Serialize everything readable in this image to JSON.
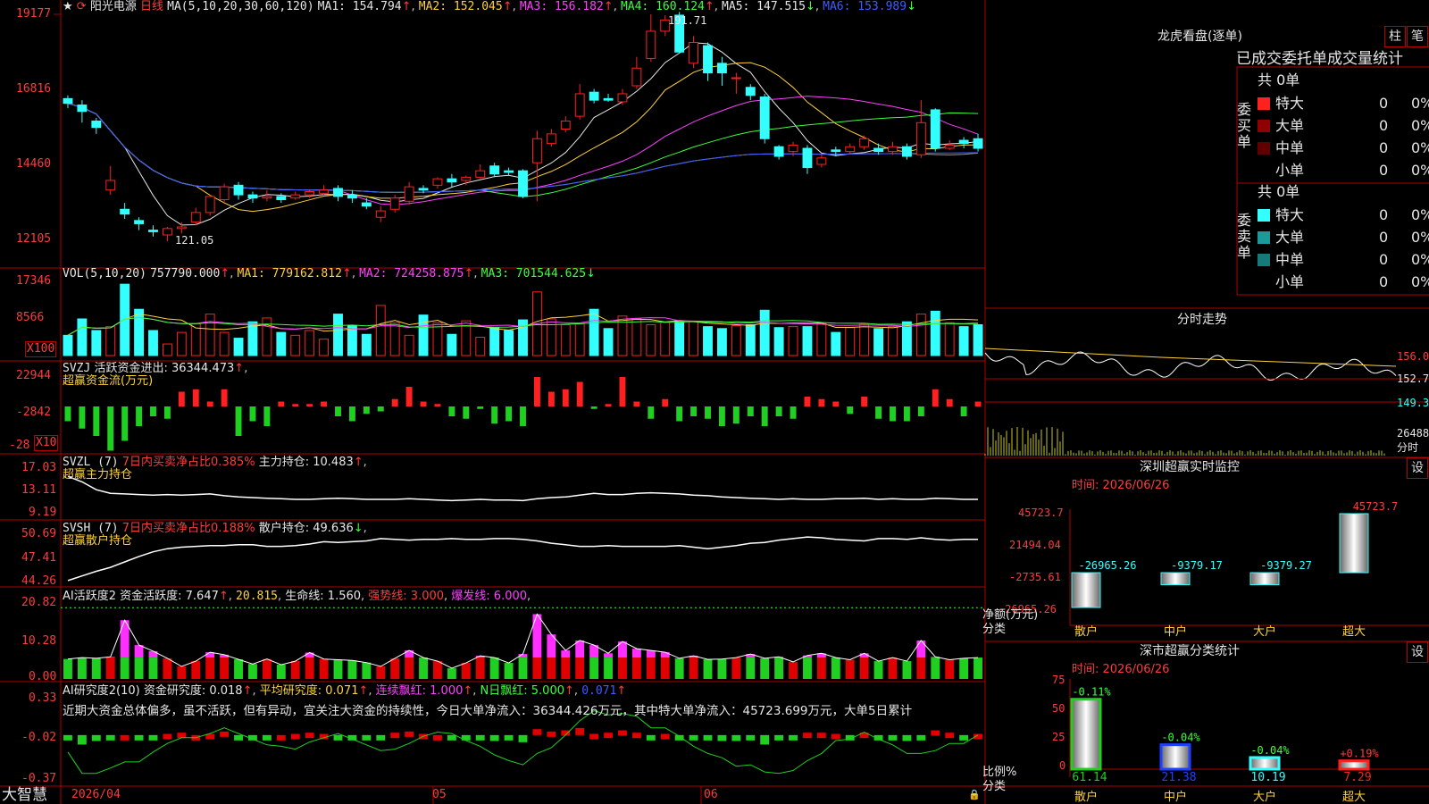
{
  "colors": {
    "up": "#ff2020",
    "down": "#3ff",
    "frame": "#b00000",
    "ma1": "#e6e6e6",
    "ma2": "#ffd23a",
    "ma3": "#ff40ff",
    "ma4": "#3cff3c",
    "ma5": "#9a9a9a",
    "ma6": "#3d5dff"
  },
  "header": {
    "star": "★",
    "stock": "阳光电源",
    "period": "日线",
    "ma_params": "MA(5,10,20,30,60,120)",
    "ma1": "MA1: 154.794",
    "ma2": "MA2: 152.045",
    "ma3": "MA3: 156.182",
    "ma4": "MA4: 160.124",
    "ma5": "MA5: 147.515",
    "ma6": "MA6: 153.989"
  },
  "price_axis": [
    "19177",
    "16816",
    "14460",
    "12105"
  ],
  "price_annotations": {
    "high": "191.71",
    "low": "121.05"
  },
  "vol_header": {
    "name": "VOL(5,10,20)",
    "v": "757790.000",
    "ma1": "MA1: 779162.812",
    "ma2": "MA2: 724258.875",
    "ma3": "MA3: 701544.625"
  },
  "vol_axis": [
    "17346",
    "8566",
    "X100"
  ],
  "svzj_header": {
    "name": "SVZJ",
    "text": "活跃资金进出: 36344.473",
    "sub": "超赢资金流(万元)"
  },
  "svzj_axis": [
    "22944",
    "-2842",
    "-28",
    "X10"
  ],
  "svzl_header": {
    "name": "SVZL (7)",
    "ratio": "7日内买卖净占比0.385%",
    "hold": "主力持仓: 10.483",
    "sub": "超赢主力持仓"
  },
  "svzl_axis": [
    "17.03",
    "13.11",
    "9.19"
  ],
  "svsh_header": {
    "name": "SVSH (7)",
    "ratio": "7日内买卖净占比0.188%",
    "hold": "散户持仓: 49.636",
    "sub": "超赢散户持仓"
  },
  "svsh_axis": [
    "50.69",
    "47.41",
    "44.26"
  ],
  "ai1_header": {
    "name": "AI活跃度2",
    "active": "资金活跃度: 7.647",
    "v2": "20.815",
    "life": "生命线: 1.560",
    "strong": "强势线: 3.000",
    "burst": "爆发线: 6.000"
  },
  "ai1_axis": [
    "20.82",
    "10.28",
    "0.00"
  ],
  "ai2_header": {
    "name": "AI研究度2(10)",
    "fund": "资金研究度: 0.018",
    "avg": "平均研究度: 0.071",
    "red": "连续飘红: 1.000",
    "nred": "N日飘红: 5.000",
    "last": "0.071"
  },
  "ai2_axis": [
    "0.33",
    "-0.02",
    "-0.37"
  ],
  "commentary": "近期大资金总体偏多，虽不活跃，但有异动，宜关注大资金的持续性，今日大单净流入：36344.426万元，其中特大单净流入：45723.699万元，大单5日累计",
  "bottom": {
    "brand": "大智慧",
    "dates": [
      "2026/04",
      "05",
      "06"
    ]
  },
  "right": {
    "title": "龙虎看盘(逐单)",
    "btn1": "柱",
    "btn2": "笔",
    "heading": "已成交委托单成交量统计",
    "buy": {
      "label": "委买单",
      "total": "共 0单",
      "rows": [
        {
          "name": "特大",
          "v": "0",
          "p": "0%",
          "c": "#ff2020"
        },
        {
          "name": "大单",
          "v": "0",
          "p": "0%",
          "c": "#900000"
        },
        {
          "name": "中单",
          "v": "0",
          "p": "0%",
          "c": "#600000"
        },
        {
          "name": "小单",
          "v": "0",
          "p": "0%",
          "c": ""
        }
      ]
    },
    "sell": {
      "label": "委卖单",
      "total": "共 0单",
      "rows": [
        {
          "name": "特大",
          "v": "0",
          "p": "0%",
          "c": "#3ff"
        },
        {
          "name": "大单",
          "v": "0",
          "p": "0%",
          "c": "#1a9a9a"
        },
        {
          "name": "中单",
          "v": "0",
          "p": "0%",
          "c": "#157a7a"
        },
        {
          "name": "小单",
          "v": "0",
          "p": "0%",
          "c": ""
        }
      ]
    },
    "intraday": {
      "title": "分时走势",
      "axis": [
        "156.0",
        "152.7",
        "149.3",
        "26488"
      ],
      "unit": "分时"
    },
    "monitor": {
      "title": "深圳超赢实时监控",
      "btn": "设",
      "time": "时间: 2026/06/26",
      "axis": [
        "45723.7",
        "21494.04",
        "-2735.61",
        "-26965.26"
      ],
      "ylabel": "净额(万元)",
      "xlabel": "分类",
      "cats": [
        "散户",
        "中户",
        "大户",
        "超大"
      ],
      "values": [
        -26965.26,
        -9379.17,
        -9379.27,
        45723.7
      ],
      "labels": [
        "-26965.26",
        "-9379.17",
        "-9379.27",
        "45723.7"
      ]
    },
    "stats": {
      "title": "深市超赢分类统计",
      "btn": "设",
      "time": "时间: 2026/06/26",
      "axis": [
        "75",
        "50",
        "25",
        "0"
      ],
      "ylabel": "比例%",
      "xlabel": "分类",
      "cats": [
        "散户",
        "中户",
        "大户",
        "超大"
      ],
      "values": [
        61.14,
        21.38,
        10.19,
        7.29
      ],
      "changes": [
        "-0.11%",
        "-0.04%",
        "-0.04%",
        "+0.19%"
      ]
    }
  },
  "chart_data": {
    "type": "candlestick",
    "title": "阳光电源 日线",
    "xlabel": "",
    "ylabel": "",
    "x_ticks": [
      "2026/04",
      "05",
      "06"
    ],
    "ylim": [
      121.05,
      191.77
    ],
    "candles": [
      [
        165.5,
        164.0,
        166.5,
        162.5
      ],
      [
        163.5,
        161.5,
        165.0,
        158.0
      ],
      [
        158.5,
        156.5,
        159.5,
        154.5
      ],
      [
        137.0,
        140.0,
        144.5,
        135.5
      ],
      [
        131.0,
        129.5,
        133.0,
        128.0
      ],
      [
        127.5,
        126.5,
        128.5,
        124.5
      ],
      [
        124.5,
        124.0,
        126.0,
        122.5
      ],
      [
        123.0,
        125.0,
        125.5,
        121.05
      ],
      [
        125.0,
        125.5,
        127.0,
        123.5
      ],
      [
        127.0,
        130.0,
        131.5,
        126.0
      ],
      [
        130.0,
        135.0,
        135.5,
        129.0
      ],
      [
        134.0,
        138.0,
        139.0,
        133.0
      ],
      [
        138.5,
        135.5,
        139.5,
        134.0
      ],
      [
        135.5,
        134.5,
        136.5,
        133.0
      ],
      [
        134.5,
        135.0,
        137.0,
        133.5
      ],
      [
        135.0,
        134.0,
        136.0,
        133.0
      ],
      [
        134.5,
        135.5,
        136.5,
        134.0
      ],
      [
        135.5,
        136.5,
        137.0,
        134.5
      ],
      [
        136.0,
        137.0,
        138.5,
        135.5
      ],
      [
        137.5,
        135.0,
        138.5,
        133.5
      ],
      [
        135.5,
        134.5,
        137.0,
        133.0
      ],
      [
        133.0,
        132.0,
        134.5,
        131.0
      ],
      [
        128.5,
        130.5,
        132.0,
        127.0
      ],
      [
        131.0,
        134.5,
        135.5,
        130.0
      ],
      [
        133.5,
        138.0,
        139.5,
        132.5
      ],
      [
        137.5,
        137.0,
        138.5,
        136.0
      ],
      [
        138.5,
        140.5,
        141.0,
        137.5
      ],
      [
        140.5,
        139.5,
        142.0,
        138.0
      ],
      [
        140.0,
        141.0,
        141.5,
        138.5
      ],
      [
        141.0,
        143.0,
        145.0,
        140.5
      ],
      [
        144.5,
        142.0,
        145.5,
        141.0
      ],
      [
        143.0,
        142.5,
        144.0,
        141.5
      ],
      [
        143.0,
        135.0,
        143.5,
        134.5
      ],
      [
        145.5,
        153.0,
        155.5,
        133.5
      ],
      [
        151.5,
        154.5,
        156.0,
        150.5
      ],
      [
        156.0,
        158.5,
        160.0,
        155.0
      ],
      [
        160.0,
        167.0,
        170.0,
        159.0
      ],
      [
        167.5,
        165.0,
        168.5,
        164.0
      ],
      [
        165.5,
        165.0,
        167.0,
        164.5
      ],
      [
        164.5,
        167.0,
        168.5,
        163.5
      ],
      [
        169.5,
        175.0,
        178.5,
        168.5
      ],
      [
        178.0,
        186.5,
        191.77,
        177.0
      ],
      [
        186.5,
        190.0,
        191.5,
        185.0
      ],
      [
        191.5,
        180.0,
        192.5,
        179.5
      ],
      [
        176.5,
        183.0,
        185.0,
        175.0
      ],
      [
        182.0,
        173.5,
        183.0,
        171.0
      ],
      [
        176.5,
        173.5,
        178.5,
        169.5
      ],
      [
        172.0,
        172.0,
        173.5,
        167.0
      ],
      [
        169.0,
        166.5,
        170.0,
        165.0
      ],
      [
        166.0,
        153.0,
        167.0,
        151.5
      ],
      [
        150.5,
        147.5,
        151.0,
        146.5
      ],
      [
        149.0,
        151.0,
        152.0,
        147.5
      ],
      [
        150.0,
        144.0,
        151.0,
        142.0
      ],
      [
        145.0,
        147.0,
        148.5,
        144.0
      ],
      [
        149.5,
        149.0,
        150.5,
        147.5
      ],
      [
        149.0,
        150.5,
        151.5,
        148.0
      ],
      [
        150.5,
        153.0,
        154.0,
        149.5
      ],
      [
        150.0,
        149.0,
        151.5,
        148.0
      ],
      [
        149.0,
        150.5,
        152.0,
        148.0
      ],
      [
        150.5,
        147.5,
        151.5,
        146.5
      ],
      [
        148.0,
        158.0,
        165.0,
        147.0
      ],
      [
        162.0,
        150.0,
        162.5,
        149.0
      ],
      [
        150.0,
        151.0,
        152.5,
        149.5
      ],
      [
        152.5,
        151.5,
        153.5,
        150.0
      ],
      [
        153.0,
        150.0,
        154.5,
        149.0
      ]
    ],
    "volume": [
      210,
      380,
      260,
      300,
      740,
      480,
      260,
      120,
      240,
      330,
      430,
      240,
      180,
      350,
      390,
      240,
      210,
      260,
      170,
      430,
      310,
      220,
      520,
      340,
      210,
      420,
      340,
      220,
      360,
      190,
      290,
      260,
      370,
      660,
      380,
      320,
      330,
      480,
      280,
      410,
      380,
      320,
      350,
      360,
      350,
      300,
      280,
      310,
      320,
      470,
      290,
      300,
      300,
      330,
      240,
      290,
      330,
      280,
      300,
      350,
      430,
      460,
      340,
      300,
      320
    ],
    "svzj": [
      -30,
      -45,
      -60,
      -90,
      -70,
      -40,
      -20,
      -25,
      30,
      35,
      10,
      35,
      -60,
      -30,
      -40,
      10,
      5,
      5,
      10,
      -20,
      -30,
      -15,
      -10,
      15,
      40,
      10,
      5,
      -20,
      -25,
      -5,
      -35,
      -30,
      -40,
      60,
      30,
      35,
      50,
      -5,
      5,
      60,
      10,
      -25,
      15,
      -30,
      -20,
      -25,
      -40,
      -35,
      -20,
      -40,
      -20,
      -25,
      20,
      15,
      10,
      -15,
      20,
      -25,
      -30,
      -30,
      -20,
      35,
      15,
      -20,
      10
    ],
    "svzl": [
      15.8,
      14.9,
      13.6,
      13.0,
      12.9,
      12.8,
      12.7,
      12.8,
      12.7,
      12.8,
      12.9,
      12.6,
      12.4,
      12.3,
      12.2,
      12.1,
      12.0,
      12.0,
      12.1,
      12.2,
      12.1,
      12.0,
      12.0,
      12.0,
      12.1,
      12.0,
      11.9,
      11.8,
      11.9,
      12.0,
      11.9,
      11.9,
      11.8,
      12.1,
      12.3,
      12.4,
      12.7,
      13.0,
      12.8,
      12.8,
      13.0,
      13.1,
      13.0,
      12.9,
      12.7,
      12.6,
      12.4,
      12.3,
      12.2,
      12.1,
      12.0,
      12.1,
      12.0,
      12.0,
      12.1,
      12.1,
      12.2,
      12.0,
      12.1,
      12.0,
      12.0,
      12.2,
      12.1,
      12.0,
      12.0
    ],
    "svsh": [
      44.5,
      45.1,
      45.7,
      46.2,
      46.9,
      47.6,
      48.2,
      48.6,
      48.8,
      48.9,
      49.0,
      49.0,
      49.1,
      49.1,
      48.9,
      48.9,
      49.0,
      49.2,
      49.5,
      49.4,
      49.5,
      49.6,
      49.9,
      49.8,
      49.7,
      49.8,
      49.8,
      49.9,
      49.8,
      49.8,
      49.9,
      49.9,
      49.8,
      49.6,
      49.3,
      49.1,
      48.9,
      48.9,
      49.0,
      48.9,
      48.9,
      48.9,
      48.9,
      49.0,
      48.8,
      48.6,
      48.8,
      49.0,
      49.3,
      49.4,
      49.7,
      49.9,
      50.1,
      50.0,
      49.8,
      49.7,
      49.6,
      49.9,
      49.9,
      49.8,
      50.0,
      49.8,
      49.7,
      49.8,
      49.8
    ],
    "ai1": [
      5.6,
      6.0,
      5.8,
      6.2,
      16.5,
      9.5,
      7.8,
      5.8,
      3.5,
      5.0,
      7.5,
      6.8,
      5.5,
      4.2,
      5.6,
      4.0,
      5.0,
      7.4,
      5.6,
      5.4,
      5.2,
      4.6,
      3.5,
      5.8,
      8.0,
      6.0,
      5.0,
      3.0,
      4.5,
      6.5,
      6.0,
      4.5,
      7.0,
      18.2,
      12.5,
      8.0,
      10.8,
      9.5,
      7.2,
      10.5,
      8.5,
      8.0,
      7.5,
      5.8,
      6.5,
      5.5,
      5.6,
      6.0,
      7.0,
      5.8,
      6.2,
      4.8,
      6.6,
      7.2,
      6.0,
      5.4,
      7.2,
      5.0,
      6.0,
      5.0,
      10.8,
      6.2,
      5.4,
      5.8,
      6.0
    ],
    "ai2": [
      -0.02,
      -0.08,
      -0.05,
      -0.02,
      0.0,
      -0.02,
      -0.01,
      0.01,
      0.02,
      0.0,
      0.01,
      0.03,
      -0.03,
      -0.02,
      -0.04,
      0.0,
      0.01,
      0.02,
      0.01,
      -0.01,
      -0.04,
      -0.03,
      -0.02,
      0.02,
      0.03,
      0.01,
      0.0,
      -0.03,
      -0.03,
      -0.01,
      -0.05,
      -0.04,
      -0.06,
      0.05,
      0.03,
      0.04,
      0.06,
      0.01,
      0.02,
      0.04,
      0.02,
      -0.02,
      0.01,
      -0.04,
      -0.03,
      -0.03,
      -0.05,
      -0.05,
      -0.03,
      -0.08,
      -0.04,
      -0.03,
      0.02,
      0.02,
      0.01,
      -0.03,
      0.02,
      -0.03,
      -0.02,
      -0.05,
      -0.03,
      0.04,
      0.02,
      -0.02,
      0.01
    ]
  }
}
